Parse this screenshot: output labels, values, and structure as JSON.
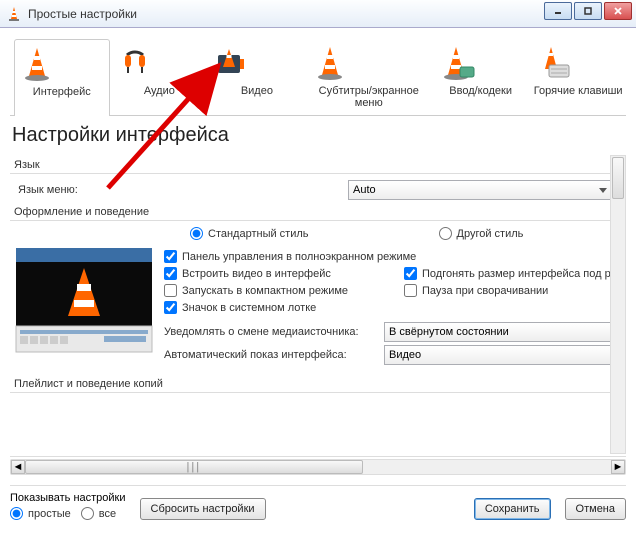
{
  "window": {
    "title": "Простые настройки"
  },
  "tabs": {
    "interface": "Интерфейс",
    "audio": "Аудио",
    "video": "Видео",
    "subtitles": "Субтитры/экранное меню",
    "input": "Ввод/кодеки",
    "hotkeys": "Горячие клавиши"
  },
  "heading": "Настройки интерфейса",
  "lang": {
    "group": "Язык",
    "label": "Язык меню:",
    "value": "Auto"
  },
  "appearance": {
    "group": "Оформление и поведение",
    "style_standard": "Стандартный стиль",
    "style_other": "Другой стиль",
    "fullscreen_ctrl": "Панель управления в полноэкранном режиме",
    "embed_video": "Встроить видео в интерфейс",
    "fit_size": "Подгонять размер интерфейса под разм",
    "compact": "Запускать в компактном режиме",
    "pause_min": "Пауза при сворачивании",
    "tray_icon": "Значок в системном лотке",
    "notify_label": "Уведомлять о смене медиаисточника:",
    "notify_value": "В свёрнутом состоянии",
    "auto_show_label": "Автоматический показ интерфейса:",
    "auto_show_value": "Видео"
  },
  "playlist_group": "Плейлист и поведение копий",
  "show_settings": {
    "label": "Показывать настройки",
    "simple": "простые",
    "all": "все"
  },
  "buttons": {
    "reset": "Сбросить настройки",
    "save": "Сохранить",
    "cancel": "Отмена"
  },
  "scrollbar_grip": "|||"
}
